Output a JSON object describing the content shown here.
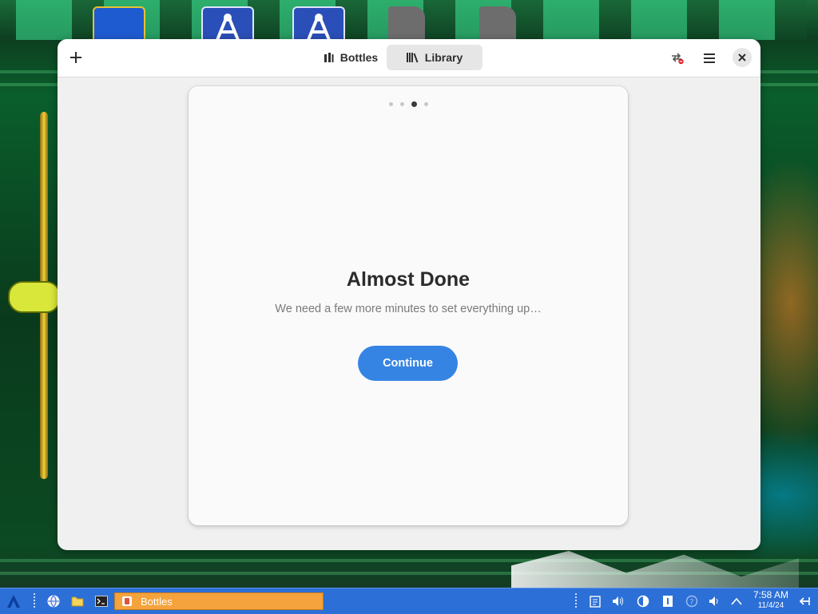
{
  "window": {
    "tabs": [
      {
        "label": "Bottles",
        "active": false
      },
      {
        "label": "Library",
        "active": true
      }
    ],
    "buttons": {
      "add": "add-icon",
      "tasks": "task-manager-icon",
      "menu": "hamburger-icon",
      "close": "close-icon"
    }
  },
  "onboarding": {
    "pages_total": 4,
    "current_page": 3,
    "title": "Almost Done",
    "subtitle": "We need a few more minutes to set everything up…",
    "continue_label": "Continue"
  },
  "taskbar": {
    "task_label": "Bottles",
    "time": "7:58 AM",
    "date": "11/4/24"
  },
  "colors": {
    "accent": "#3584e4",
    "taskbar": "#2c6fd6",
    "active_task": "#f5a33c"
  }
}
